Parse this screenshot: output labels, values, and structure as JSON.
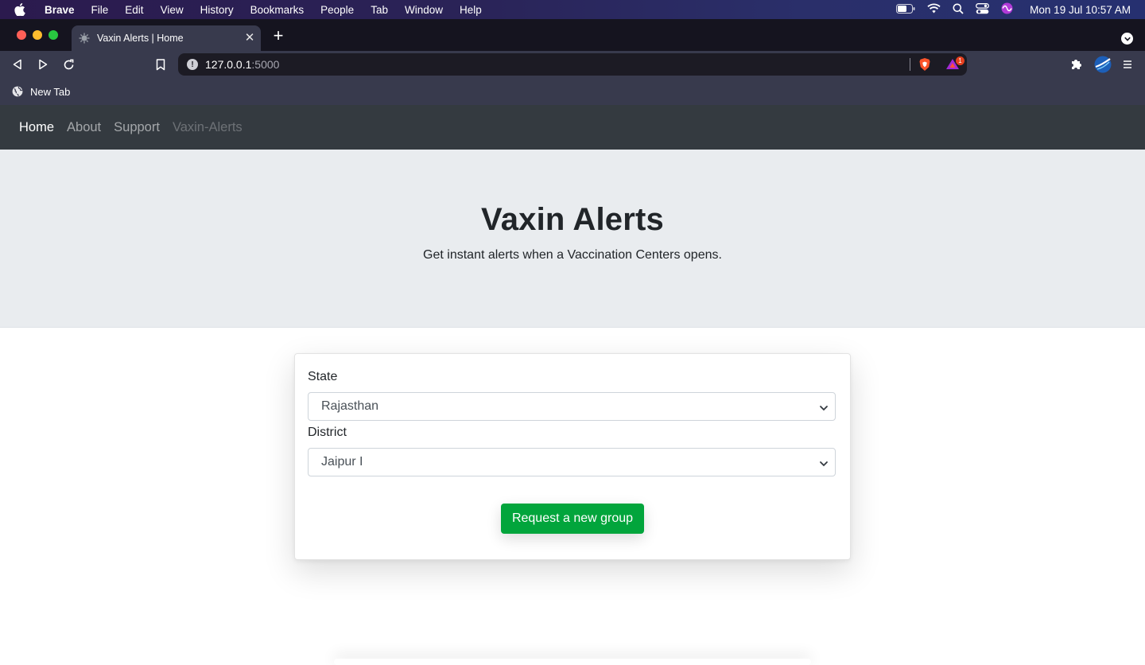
{
  "menubar": {
    "app": "Brave",
    "items": [
      "File",
      "Edit",
      "View",
      "History",
      "Bookmarks",
      "People",
      "Tab",
      "Window",
      "Help"
    ],
    "clock": "Mon 19 Jul  10:57 AM"
  },
  "tab": {
    "title": "Vaxin Alerts | Home"
  },
  "url": {
    "host": "127.0.0.1",
    "port": ":5000"
  },
  "rewards_badge": "1",
  "bookmarks": {
    "item": "New Tab"
  },
  "nav": {
    "home": "Home",
    "about": "About",
    "support": "Support",
    "brand": "Vaxin-Alerts"
  },
  "hero": {
    "title": "Vaxin Alerts",
    "subtitle": "Get instant alerts when a Vaccination Centers opens."
  },
  "form": {
    "state_label": "State",
    "state_value": "Rajasthan",
    "district_label": "District",
    "district_value": "Jaipur I",
    "submit": "Request a new group"
  },
  "colors": {
    "navbar": "#343a40",
    "jumbotron": "#e9ecef",
    "button": "#02a53c"
  }
}
